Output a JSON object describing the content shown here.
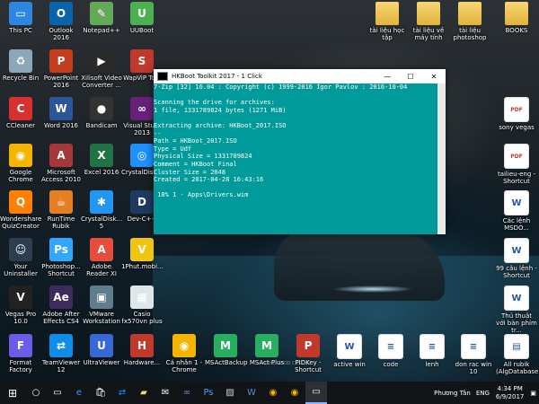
{
  "desktop_icons": [
    {
      "id": "this-pc",
      "label": "This PC",
      "color": "#2e86de",
      "glyph": "▭"
    },
    {
      "id": "outlook",
      "label": "Outlook 2016",
      "color": "#0a64ad",
      "glyph": "O"
    },
    {
      "id": "notepadpp",
      "label": "Notepad++",
      "color": "#66a85a",
      "glyph": "✎"
    },
    {
      "id": "uuboot",
      "label": "UUBoot",
      "color": "#4caf50",
      "glyph": "U"
    },
    {
      "id": "recycle-bin",
      "label": "Recycle Bin",
      "color": "#8da6b8",
      "glyph": "♻"
    },
    {
      "id": "powerpoint",
      "label": "PowerPoint 2016",
      "color": "#c43e1c",
      "glyph": "P"
    },
    {
      "id": "xilisoft",
      "label": "Xilisoft Video Converter ...",
      "color": "#2a2a2a",
      "glyph": "▶"
    },
    {
      "id": "wapvip",
      "label": "WapViP Tool",
      "color": "#c0392b",
      "glyph": "S"
    },
    {
      "id": "ccleaner",
      "label": "CCleaner",
      "color": "#d63031",
      "glyph": "C"
    },
    {
      "id": "word",
      "label": "Word 2016",
      "color": "#2b579a",
      "glyph": "W"
    },
    {
      "id": "bandicam",
      "label": "Bandicam",
      "color": "#333333",
      "glyph": "●"
    },
    {
      "id": "visual-studio",
      "label": "Visual Stu... 2013",
      "color": "#68217a",
      "glyph": "∞"
    },
    {
      "id": "chrome",
      "label": "Google Chrome",
      "color": "#f4b400",
      "glyph": "◉"
    },
    {
      "id": "access",
      "label": "Microsoft Access 2010",
      "color": "#a4373a",
      "glyph": "A"
    },
    {
      "id": "excel",
      "label": "Excel 2016",
      "color": "#217346",
      "glyph": "X"
    },
    {
      "id": "crystaldisk",
      "label": "CrystalDisk...",
      "color": "#1e90ff",
      "glyph": "◎"
    },
    {
      "id": "wondershare",
      "label": "Wondershare QuizCreator",
      "color": "#ff7f00",
      "glyph": "Q"
    },
    {
      "id": "runtime",
      "label": "RunTime Rubik",
      "color": "#e67e22",
      "glyph": "☕"
    },
    {
      "id": "crystaldisk5",
      "label": "CrystalDisk... 5",
      "color": "#2196f3",
      "glyph": "✱"
    },
    {
      "id": "devcpp",
      "label": "Dev-C++",
      "color": "#1f3a60",
      "glyph": "D"
    },
    {
      "id": "uninstaller",
      "label": "Your Uninstaller",
      "color": "#2c3e50",
      "glyph": "☺"
    },
    {
      "id": "photoshop-shortcut",
      "label": "Photoshop... Shortcut",
      "color": "#31a8ff",
      "glyph": "Ps"
    },
    {
      "id": "adobe-reader",
      "label": "Adobe Reader XI",
      "color": "#e74c3c",
      "glyph": "A"
    },
    {
      "id": "1phut",
      "label": "1Phut.mobi...",
      "color": "#f1c40f",
      "glyph": "V"
    },
    {
      "id": "vegas",
      "label": "Vegas Pro 10.0",
      "color": "#222222",
      "glyph": "V"
    },
    {
      "id": "after-effects",
      "label": "Adobe After Effects CS4",
      "color": "#3d2b5c",
      "glyph": "Ae"
    },
    {
      "id": "vmware",
      "label": "VMware Workstation",
      "color": "#607d8b",
      "glyph": "▣"
    },
    {
      "id": "casio",
      "label": "Casio fx570vn plus",
      "color": "#dfe6e9",
      "glyph": "▦"
    },
    {
      "id": "format-factory",
      "label": "Format Factory",
      "color": "#6c5ce7",
      "glyph": "F"
    },
    {
      "id": "teamviewer",
      "label": "TeamViewer 12",
      "color": "#0e8ee9",
      "glyph": "⇄"
    },
    {
      "id": "ultraviewer",
      "label": "UltraViewer",
      "color": "#3867d6",
      "glyph": "U"
    },
    {
      "id": "hardware",
      "label": "Hardware...",
      "color": "#c0392b",
      "glyph": "H"
    },
    {
      "id": "canhan",
      "label": "Cá nhân 1 - Chrome",
      "color": "#f4b400",
      "glyph": "◉"
    },
    {
      "id": "msactbackup",
      "label": "MSActBackup",
      "color": "#27ae60",
      "glyph": "M"
    },
    {
      "id": "msact-plus",
      "label": "MSAct Plus",
      "color": "#27ae60",
      "glyph": "M"
    },
    {
      "id": "pidkey",
      "label": "PIDKey - Shortcut",
      "color": "#c0392b",
      "glyph": "P"
    },
    {
      "id": "active-win",
      "label": "active win",
      "color": "#2b579a",
      "glyph": "W"
    },
    {
      "id": "code",
      "label": "code",
      "color": "#eeeeee",
      "glyph": "≡"
    },
    {
      "id": "lenh",
      "label": "lenh",
      "color": "#eeeeee",
      "glyph": "≡"
    },
    {
      "id": "don-rac",
      "label": "don rac win 10",
      "color": "#eeeeee",
      "glyph": "≡"
    },
    {
      "id": "all-rubik",
      "label": "All rubik (AlgDatabase)",
      "color": "#eeeeee",
      "glyph": "▤"
    },
    {
      "id": "tailieu-hoc-tap",
      "label": "tài liệu học tập",
      "color": "#e2b33d",
      "glyph": ""
    },
    {
      "id": "tailieu-may-tinh",
      "label": "tài liệu về máy tính",
      "color": "#e2b33d",
      "glyph": ""
    },
    {
      "id": "tailieu-photoshop",
      "label": "tài liệu photoshop",
      "color": "#e2b33d",
      "glyph": ""
    },
    {
      "id": "books",
      "label": "BOOKS",
      "color": "#e2b33d",
      "glyph": ""
    },
    {
      "id": "sony-vegas",
      "label": "sony vegas",
      "color": "#ffffff",
      "glyph": "PDF"
    },
    {
      "id": "tailieu-eng",
      "label": "tailieu-eng - Shortcut",
      "color": "#ffffff",
      "glyph": "PDF"
    },
    {
      "id": "cac-lenh-msdos",
      "label": "Các lệnh MSDO...",
      "color": "#ffffff",
      "glyph": "W"
    },
    {
      "id": "99-cau-lenh",
      "label": "99 câu lệnh - Shortcut",
      "color": "#ffffff",
      "glyph": "W"
    },
    {
      "id": "thu-thuat",
      "label": "Thủ thuật với bàn phím tr...",
      "color": "#ffffff",
      "glyph": "W"
    }
  ],
  "console": {
    "title": "HKBoot Toolkit 2017 - 1 Click",
    "minimize": "—",
    "maximize": "☐",
    "close": "✕",
    "lines": [
      "7-Zip [32] 16.04 : Copyright (c) 1999-2016 Igor Pavlov : 2016-10-04",
      "",
      "Scanning the drive for archives:",
      "1 file, 1331789824 bytes (1271 MiB)",
      "",
      "Extracting archive: HKBoot_2017.ISO",
      "--",
      "Path = HKBoot_2017.ISO",
      "Type = Udf",
      "Physical Size = 1331789824",
      "Comment = HKBoot Final",
      "Cluster Size = 2048",
      "Created = 2017-04-28 16:43:16",
      "",
      " 18% 1 - Apps\\Drivers.wim"
    ]
  },
  "taskbar": {
    "start": "⊞",
    "search": "○",
    "task_view": "▭",
    "pinned": [
      {
        "id": "edge",
        "glyph": "e",
        "color": "#3b99fc"
      },
      {
        "id": "store",
        "glyph": "🛍",
        "color": "#ffffff"
      },
      {
        "id": "teamviewer",
        "glyph": "⇄",
        "color": "#0e8ee9"
      },
      {
        "id": "explorer",
        "glyph": "▰",
        "color": "#f7d774"
      },
      {
        "id": "mail",
        "glyph": "✉",
        "color": "#ffffff"
      },
      {
        "id": "vs",
        "glyph": "∞",
        "color": "#a971d1"
      },
      {
        "id": "photoshop",
        "glyph": "Ps",
        "color": "#31a8ff"
      },
      {
        "id": "photos",
        "glyph": "▨",
        "color": "#cccccc"
      },
      {
        "id": "word",
        "glyph": "W",
        "color": "#5b8bd6"
      },
      {
        "id": "chrome",
        "glyph": "◉",
        "color": "#f4b400"
      },
      {
        "id": "chrome2",
        "glyph": "◉",
        "color": "#f4b400"
      },
      {
        "id": "console",
        "glyph": "▭",
        "color": "#ffffff"
      }
    ],
    "tray_user": "Phương Tân",
    "tray_lang": "ENG",
    "time": "4:34 PM",
    "date": "6/9/2017",
    "notifications": "▣"
  },
  "watermark": "KOOKL GOOD CASTLE ..."
}
